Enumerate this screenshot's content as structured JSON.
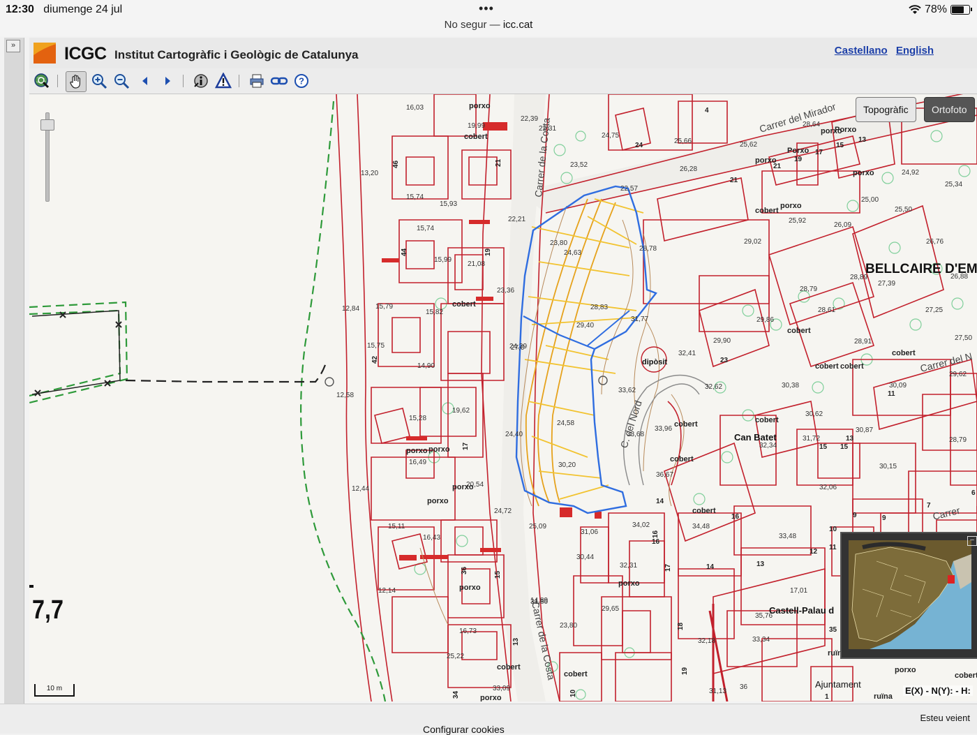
{
  "status_bar": {
    "time": "12:30",
    "date": "diumenge 24 jul",
    "battery": "78%",
    "battery_level": 0.78,
    "url_security": "No segur —",
    "url_host": "icc.cat"
  },
  "header": {
    "brand_short": "ICGC",
    "brand_full": "Institut Cartogràfic i Geològic de Catalunya",
    "lang_es": "Castellano",
    "lang_en": "English",
    "logo_color": "#f0a21e"
  },
  "toolbar": {
    "buttons": [
      "globe-search-icon",
      "pan-hand-icon",
      "zoom-in-icon",
      "zoom-out-icon",
      "previous-view-icon",
      "next-view-icon",
      "info-icon",
      "warning-icon",
      "print-icon",
      "link-icon",
      "help-icon"
    ],
    "active": "pan-hand-icon"
  },
  "map": {
    "layers": {
      "topografic": "Topogràfic",
      "ortofoto": "Ortofoto",
      "selected": "topografic"
    },
    "side_value": "7,7",
    "scale_label": "10 m",
    "coords_readout": "E(X) - N(Y): - H:",
    "streets": {
      "mirador": "Carrer del Mirador",
      "costa_top": "Carrer de la Costa",
      "costa_bottom": "Carrer de la Costa",
      "nord": "C. del Nord",
      "carrer_n": "Carrer del N",
      "carrer_right": "Carrer"
    },
    "places": {
      "bellcaire": "BELLCAIRE D'EMPO",
      "can_batet": "Can Batet",
      "castell": "Castell-Palau d",
      "ajuntament": "Ajuntament",
      "diposit": "dipòsit"
    },
    "annotations": {
      "porxo": "porxo",
      "cobert": "cobert",
      "porxo_cap": "Porxo",
      "ruina": "ruïna"
    },
    "elevations": [
      "16,03",
      "19,99",
      "22,39",
      "22,31",
      "24,75",
      "25,66",
      "25,62",
      "28,64",
      "13,20",
      "15,74",
      "15,93",
      "23,52",
      "26,28",
      "24,92",
      "25,34",
      "25,00",
      "25,92",
      "26,09",
      "25,50",
      "22,21",
      "22,57",
      "23,80",
      "24,63",
      "15,74",
      "15,99",
      "21,08",
      "28,78",
      "29,02",
      "26,76",
      "28,89",
      "27,39",
      "26,88",
      "12,84",
      "15,79",
      "15,82",
      "23,36",
      "29,86",
      "28,79",
      "28,61",
      "27,25",
      "15,75",
      "14,90",
      "24,39",
      "28,83",
      "29,40",
      "31,77",
      "29,90",
      "28,91",
      "27,50",
      "12,58",
      "15,28",
      "19,62",
      "27,0",
      "33,62",
      "32,41",
      "32,62",
      "30,38",
      "30,09",
      "29,62",
      "33,96",
      "33,68",
      "32,34",
      "30,62",
      "31,72",
      "30,87",
      "28,79",
      "12,44",
      "16,49",
      "20,54",
      "24,40",
      "24,58",
      "30,20",
      "36,67",
      "32,06",
      "30,15",
      "15,11",
      "16,43",
      "24,72",
      "25,09",
      "31,06",
      "34,48",
      "34,02",
      "33,48",
      "12,14",
      "30,44",
      "32,31",
      "29,65",
      "31,80",
      "35,76",
      "33,34",
      "17,01",
      "16,73",
      "25,22",
      "23,80",
      "14,89",
      "33,09",
      "32,18",
      "31,13",
      "36"
    ],
    "numbers": [
      "46",
      "21",
      "44",
      "19",
      "42",
      "17",
      "36",
      "15",
      "13",
      "34",
      "16",
      "17",
      "18",
      "19",
      "10",
      "24",
      "4",
      "21",
      "19",
      "17",
      "15",
      "13",
      "21",
      "23",
      "14",
      "15",
      "13",
      "9",
      "11",
      "6",
      "15",
      "16",
      "14",
      "13",
      "12",
      "11",
      "10",
      "9",
      "7",
      "1",
      "35",
      "16"
    ]
  },
  "footer": {
    "cookies": "Configurar cookies",
    "viewing": "Esteu veient"
  }
}
